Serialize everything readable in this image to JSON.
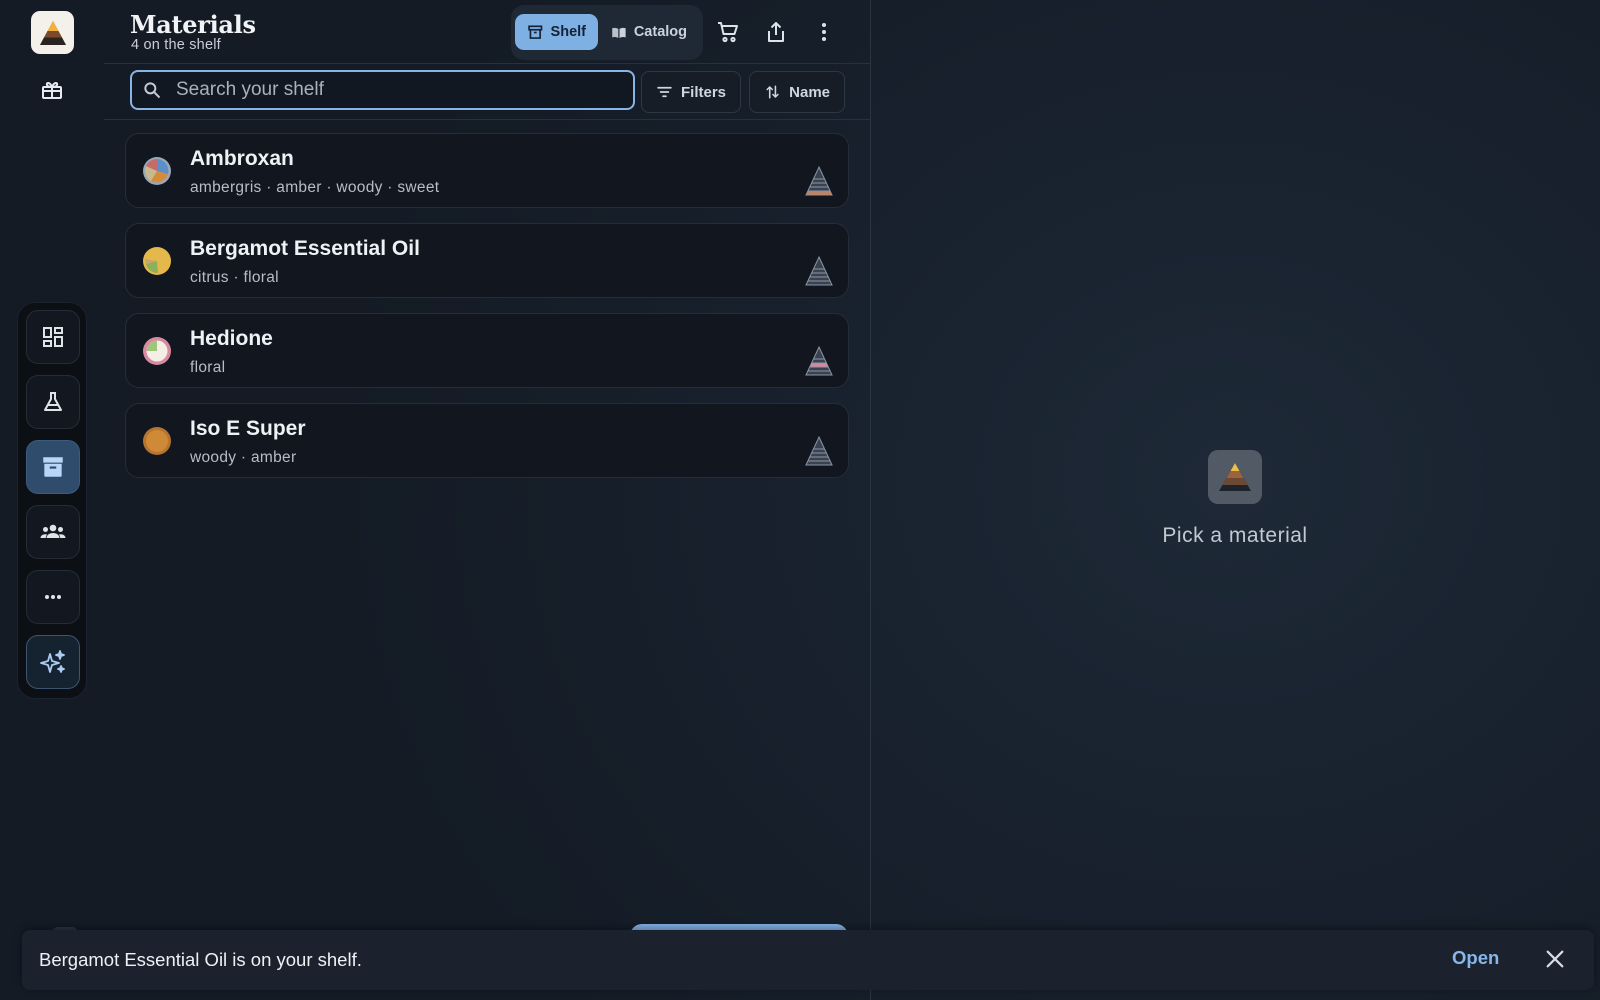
{
  "header": {
    "title": "Materials",
    "subtitle": "4 on the shelf"
  },
  "view_toggle": {
    "shelf_label": "Shelf",
    "catalog_label": "Catalog",
    "selected": "Shelf"
  },
  "header_actions": [
    "cart-icon",
    "share-icon",
    "more-vert-icon"
  ],
  "search": {
    "placeholder": "Search your shelf",
    "value": ""
  },
  "toolbar": {
    "filters_label": "Filters",
    "sort_label": "Name"
  },
  "materials": [
    {
      "name": "Ambroxan",
      "tags": "ambergris · amber · woody · sweet"
    },
    {
      "name": "Bergamot Essential Oil",
      "tags": "citrus · floral"
    },
    {
      "name": "Hedione",
      "tags": "floral"
    },
    {
      "name": "Iso E Super",
      "tags": "woody · amber"
    }
  ],
  "nav": {
    "top_icons": [
      "app-logo",
      "gift-icon"
    ],
    "dock_items": [
      "dashboard-icon",
      "flask-icon",
      "archive-icon",
      "group-icon",
      "more-horiz-icon",
      "sparkle-icon"
    ],
    "active": "archive-icon"
  },
  "detail": {
    "empty_text": "Pick a material"
  },
  "snackbar": {
    "message": "Bergamot Essential Oil is on your shelf.",
    "action_label": "Open"
  },
  "colors": {
    "accent": "#7fb0e4",
    "background": "#17202c",
    "card": "#12171f"
  }
}
